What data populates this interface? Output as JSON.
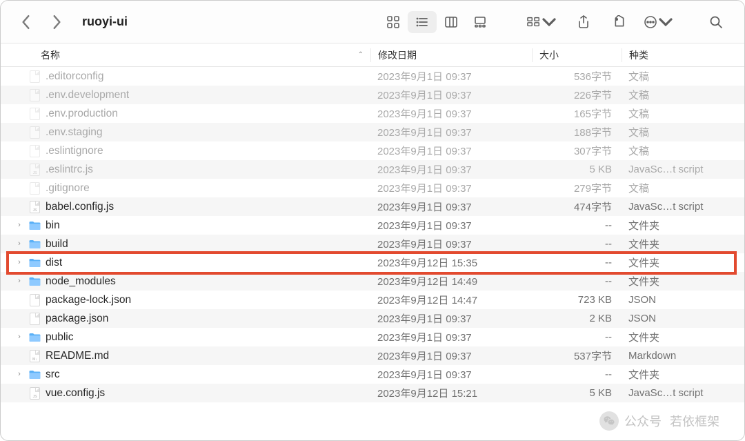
{
  "window": {
    "title": "ruoyi-ui"
  },
  "toolbar": {
    "group_label": "共享"
  },
  "columns": {
    "name": "名称",
    "date": "修改日期",
    "size": "大小",
    "kind": "种类"
  },
  "highlight_index": 10,
  "watermark": {
    "label": "公众号",
    "brand": "若依框架"
  },
  "rows": [
    {
      "name": ".editorconfig",
      "type": "file",
      "dim": true,
      "date": "2023年9月1日 09:37",
      "size": "536字节",
      "kind": "文稿"
    },
    {
      "name": ".env.development",
      "type": "file",
      "dim": true,
      "date": "2023年9月1日 09:37",
      "size": "226字节",
      "kind": "文稿"
    },
    {
      "name": ".env.production",
      "type": "file",
      "dim": true,
      "date": "2023年9月1日 09:37",
      "size": "165字节",
      "kind": "文稿"
    },
    {
      "name": ".env.staging",
      "type": "file",
      "dim": true,
      "date": "2023年9月1日 09:37",
      "size": "188字节",
      "kind": "文稿"
    },
    {
      "name": ".eslintignore",
      "type": "file",
      "dim": true,
      "date": "2023年9月1日 09:37",
      "size": "307字节",
      "kind": "文稿"
    },
    {
      "name": ".eslintrc.js",
      "type": "js",
      "dim": true,
      "date": "2023年9月1日 09:37",
      "size": "5 KB",
      "kind": "JavaSc…t script"
    },
    {
      "name": ".gitignore",
      "type": "file",
      "dim": true,
      "date": "2023年9月1日 09:37",
      "size": "279字节",
      "kind": "文稿"
    },
    {
      "name": "babel.config.js",
      "type": "js",
      "dim": false,
      "date": "2023年9月1日 09:37",
      "size": "474字节",
      "kind": "JavaSc…t script"
    },
    {
      "name": "bin",
      "type": "folder",
      "dim": false,
      "date": "2023年9月1日 09:37",
      "size": "--",
      "kind": "文件夹"
    },
    {
      "name": "build",
      "type": "folder",
      "dim": false,
      "date": "2023年9月1日 09:37",
      "size": "--",
      "kind": "文件夹"
    },
    {
      "name": "dist",
      "type": "folder",
      "dim": false,
      "date": "2023年9月12日 15:35",
      "size": "--",
      "kind": "文件夹"
    },
    {
      "name": "node_modules",
      "type": "folder",
      "dim": false,
      "date": "2023年9月12日 14:49",
      "size": "--",
      "kind": "文件夹"
    },
    {
      "name": "package-lock.json",
      "type": "file",
      "dim": false,
      "date": "2023年9月12日 14:47",
      "size": "723 KB",
      "kind": "JSON"
    },
    {
      "name": "package.json",
      "type": "file",
      "dim": false,
      "date": "2023年9月1日 09:37",
      "size": "2 KB",
      "kind": "JSON"
    },
    {
      "name": "public",
      "type": "folder",
      "dim": false,
      "date": "2023年9月1日 09:37",
      "size": "--",
      "kind": "文件夹"
    },
    {
      "name": "README.md",
      "type": "md",
      "dim": false,
      "date": "2023年9月1日 09:37",
      "size": "537字节",
      "kind": "Markdown"
    },
    {
      "name": "src",
      "type": "folder",
      "dim": false,
      "date": "2023年9月1日 09:37",
      "size": "--",
      "kind": "文件夹"
    },
    {
      "name": "vue.config.js",
      "type": "js",
      "dim": false,
      "date": "2023年9月12日 15:21",
      "size": "5 KB",
      "kind": "JavaSc…t script"
    }
  ]
}
